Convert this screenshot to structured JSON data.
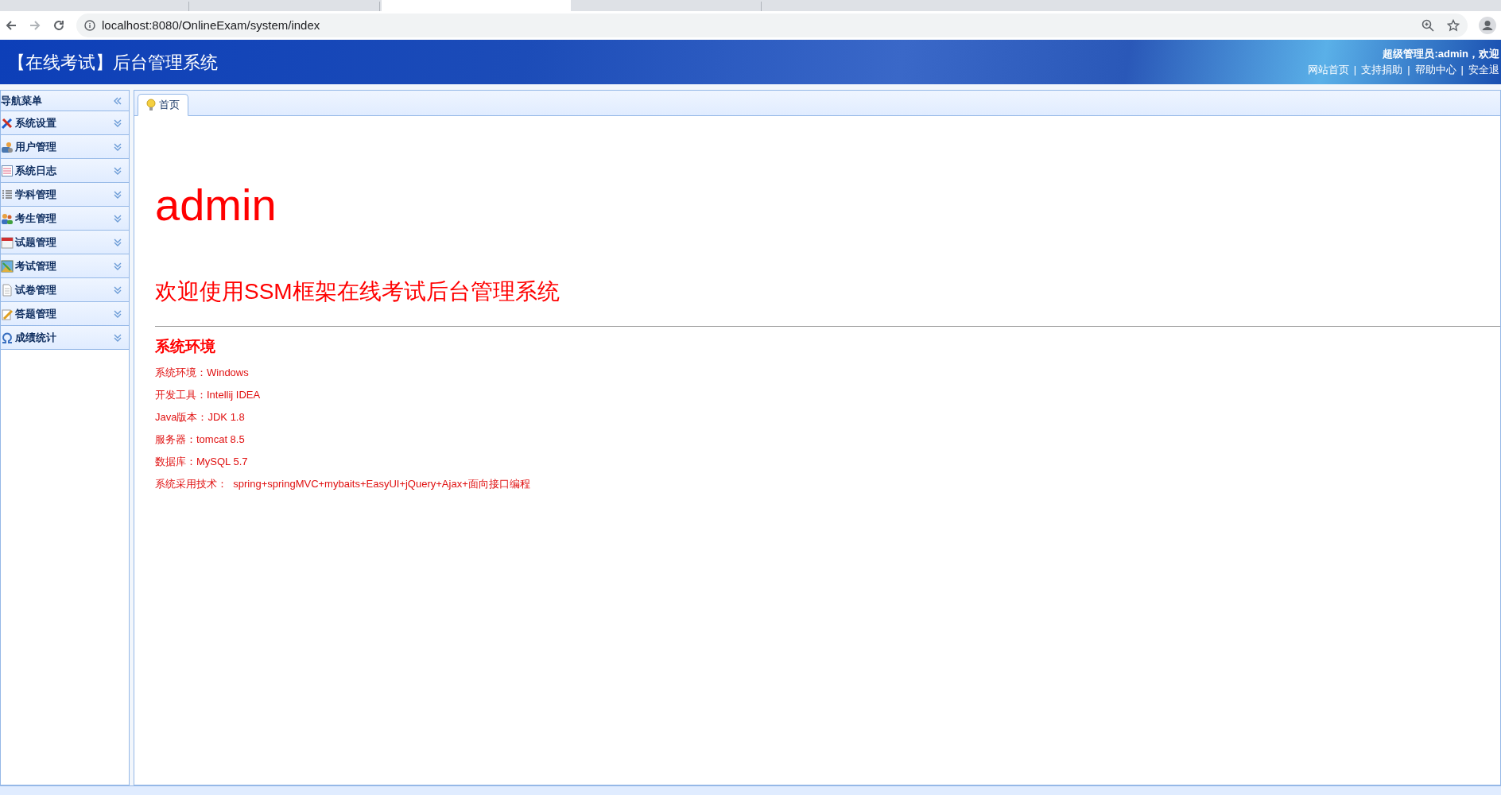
{
  "browser": {
    "tabs": [
      {
        "selected": false
      },
      {
        "selected": false
      },
      {
        "selected": true
      },
      {
        "selected": false
      }
    ],
    "url": "localhost:8080/OnlineExam/system/index"
  },
  "header": {
    "title": "【在线考试】后台管理系统",
    "user": "超级管理员:admin，欢迎",
    "links": [
      "网站首页",
      "支持捐助",
      "帮助中心",
      "安全退"
    ],
    "separators": [
      "|",
      "|",
      "|"
    ]
  },
  "sidebar": {
    "title": "导航菜单",
    "items": [
      {
        "label": "系统设置",
        "kind": "tools"
      },
      {
        "label": "用户管理",
        "kind": "users"
      },
      {
        "label": "系统日志",
        "kind": "log"
      },
      {
        "label": "学科管理",
        "kind": "list"
      },
      {
        "label": "考生管理",
        "kind": "people"
      },
      {
        "label": "试题管理",
        "kind": "calendar"
      },
      {
        "label": "考试管理",
        "kind": "map"
      },
      {
        "label": "试卷管理",
        "kind": "doc"
      },
      {
        "label": "答题管理",
        "kind": "edit"
      },
      {
        "label": "成绩统计",
        "kind": "omega"
      }
    ]
  },
  "tabs": [
    {
      "label": "首页",
      "selected": true
    }
  ],
  "content": {
    "name": "admin",
    "welcome": "欢迎使用SSM框架在线考试后台管理系统",
    "section": "系统环境",
    "lines": [
      "系统环境：Windows",
      "开发工具：Intellij IDEA",
      "Java版本：JDK 1.8",
      "服务器：tomcat 8.5",
      "数据库：MySQL 5.7",
      "系统采用技术：  spring+springMVC+mybaits+EasyUI+jQuery+Ajax+面向接口编程"
    ]
  }
}
